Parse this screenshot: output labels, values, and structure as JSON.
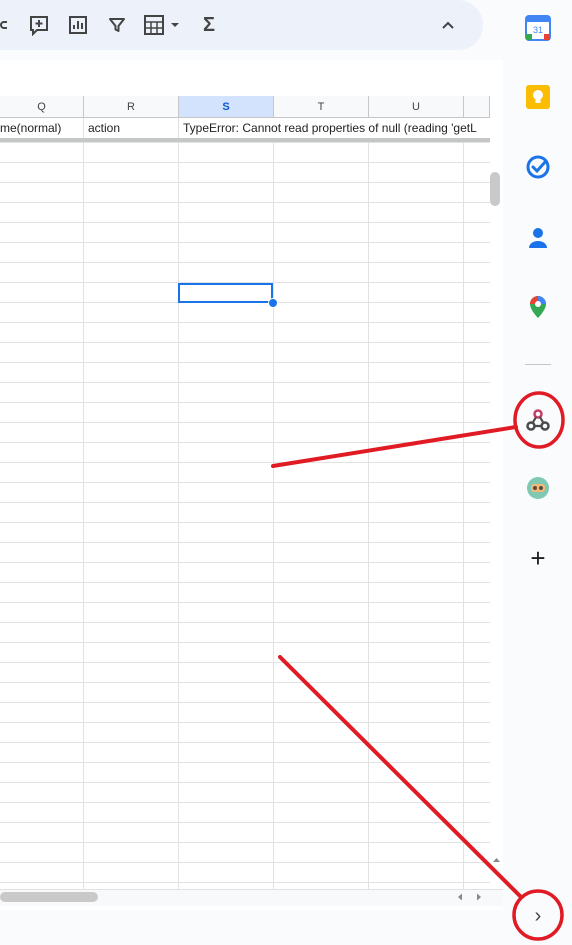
{
  "toolbar": {
    "icons": [
      "link-icon",
      "insert-comment-icon",
      "insert-chart-icon",
      "filter-icon",
      "filter-views-icon",
      "functions-icon",
      "collapse-menu-icon"
    ],
    "functions_label": "Σ"
  },
  "sheet": {
    "columns": [
      "Q",
      "R",
      "S",
      "T",
      "U"
    ],
    "selected_column": "S",
    "row1": {
      "Q": "me(normal)",
      "R": "action",
      "S": "TypeError: Cannot read properties of null (reading 'getL"
    }
  },
  "sidepanel": {
    "apps": [
      {
        "name": "Calendar",
        "badge": "31"
      },
      {
        "name": "Keep"
      },
      {
        "name": "Tasks"
      },
      {
        "name": "Contacts"
      },
      {
        "name": "Maps"
      },
      {
        "name": "Webhook"
      },
      {
        "name": "Bot add-on"
      },
      {
        "name": "Get add-ons",
        "symbol": "+"
      }
    ],
    "expand_label": "›"
  }
}
